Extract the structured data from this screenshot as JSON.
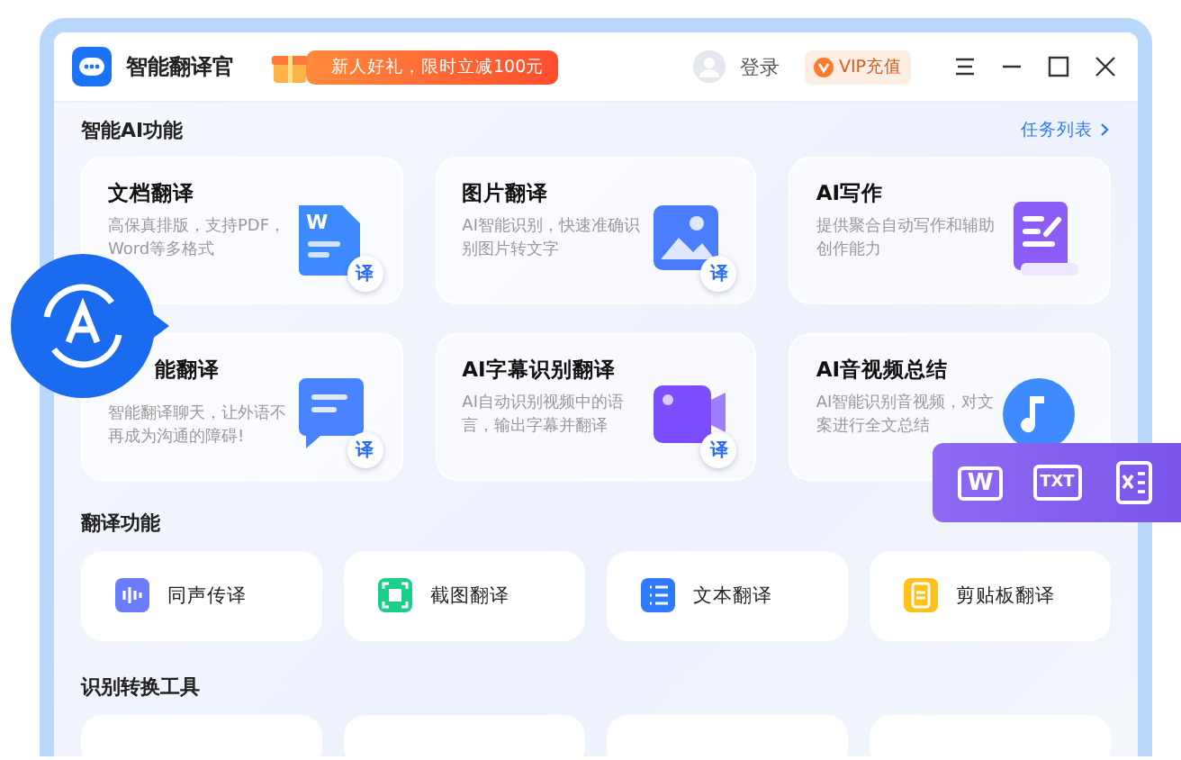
{
  "titlebar": {
    "app_name": "智能翻译官",
    "promo": "新人好礼，限时立减100元",
    "login": "登录",
    "vip": "VIP充值"
  },
  "ai_section": {
    "title": "智能AI功能",
    "link": "任务列表",
    "cards": [
      {
        "kind": "doc",
        "title": "文档翻译",
        "desc": "高保真排版，支持PDF，Word等多格式",
        "mark": "W",
        "badge": "译"
      },
      {
        "kind": "image",
        "title": "图片翻译",
        "desc": "AI智能识别，快速准确识别图片转文字",
        "badge": "译"
      },
      {
        "kind": "write",
        "title": "AI写作",
        "desc": "提供聚合自动写作和辅助创作能力"
      },
      {
        "kind": "chat",
        "title": "能翻译",
        "desc": "智能翻译聊天，让外语不再成为沟通的障碍!",
        "badge": "译"
      },
      {
        "kind": "video",
        "title": "AI字幕识别翻译",
        "desc": "AI自动识别视频中的语言，输出字幕并翻译",
        "badge": "译"
      },
      {
        "kind": "audio",
        "title": "AI音视频总结",
        "desc": "AI智能识别音视频，对文案进行全文总结"
      }
    ]
  },
  "translate_section": {
    "title": "翻译功能",
    "tools": [
      {
        "kind": "voice",
        "label": "同声传译"
      },
      {
        "kind": "screenshot",
        "label": "截图翻译"
      },
      {
        "kind": "text",
        "label": "文本翻译"
      },
      {
        "kind": "clipboard",
        "label": "剪贴板翻译"
      }
    ]
  },
  "convert_section": {
    "title": "识别转换工具"
  },
  "format_popup": {
    "formats": [
      {
        "kind": "word",
        "label": "W"
      },
      {
        "kind": "txt",
        "label": "TXT"
      },
      {
        "kind": "excel"
      }
    ]
  }
}
